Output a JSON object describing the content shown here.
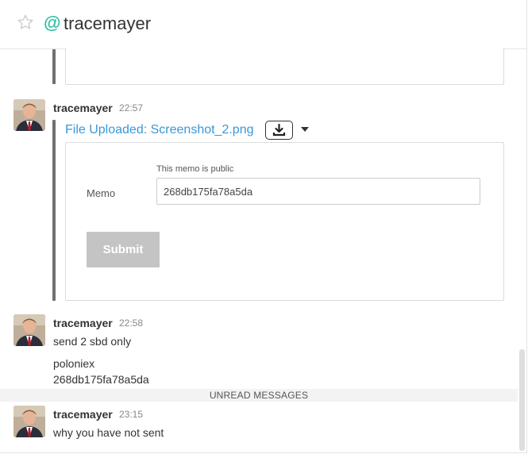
{
  "header": {
    "star_icon": "star-outline-icon",
    "at_symbol": "@",
    "room_name": "tracemayer"
  },
  "messages": [
    {
      "user": "tracemayer",
      "time": "22:57",
      "file_link": "File Uploaded: Screenshot_2.png",
      "download_icon": "download-icon",
      "menu_icon": "caret-down-icon",
      "form": {
        "note": "This memo is public",
        "label": "Memo",
        "value": "268db175fa78a5da",
        "submit_label": "Submit"
      }
    },
    {
      "user": "tracemayer",
      "time": "22:58",
      "line1": "send 2 sbd only",
      "line2": "poloniex",
      "line3": "268db175fa78a5da"
    },
    {
      "user": "tracemayer",
      "time": "23:15",
      "line1": "why you have not sent"
    }
  ],
  "unread_label": "UNREAD MESSAGES",
  "colors": {
    "accent": "#2ebfa5",
    "link": "#3a98d6",
    "submit_disabled": "#c4c4c4"
  }
}
